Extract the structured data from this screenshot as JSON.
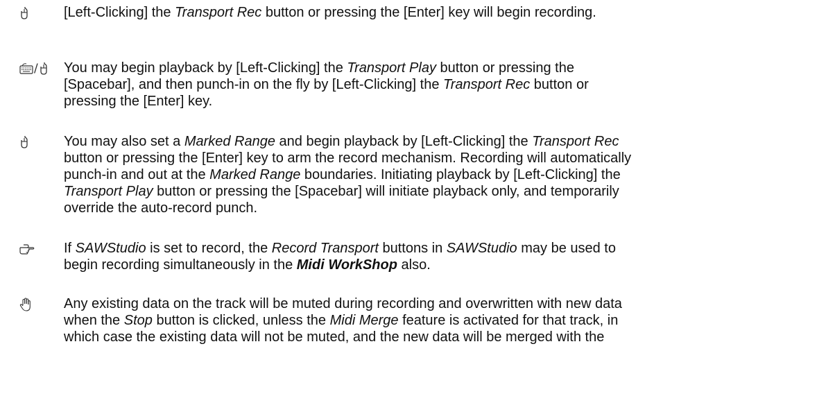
{
  "paragraphs": [
    {
      "icon": "mouse-icon",
      "p1": "[Left-Clicking] the ",
      "i1": "Transport Rec",
      "p2": " button or pressing the [Enter] key will begin recording."
    },
    {
      "icon": "keyboard-icon",
      "icon2": "mouse-icon",
      "icon_sep": "/",
      "p1": "You may begin playback by [Left-Clicking] the ",
      "i1": "Transport Play",
      "p2": " button or pressing the",
      "p3": "[Spacebar], and then punch-in on the fly by [Left-Clicking] the ",
      "i2": "Transport Rec",
      "p4": " button or",
      "p5": "pressing the [Enter] key."
    },
    {
      "icon": "mouse-icon",
      "p1": "You may also set a ",
      "i1": "Marked Range",
      "p2": " and begin playback by [Left-Clicking] the ",
      "i2": "Transport Rec",
      "p3": "button or pressing the [Enter] key to arm the record mechanism. Recording will automatically",
      "p4": "punch-in and out at the ",
      "i3": "Marked Range",
      "p5": " boundaries. Initiating playback by [Left-Clicking] the",
      "i4": "Transport Play",
      "p6": " button or pressing the [Spacebar] will initiate playback only, and temporarily",
      "p7": "override the auto-record punch."
    },
    {
      "icon": "pointing-hand-icon",
      "p1": "If ",
      "i1": "SAWStudio",
      "p2": " is set to record, the ",
      "i2": "Record Transport",
      "p3": " buttons in ",
      "i3": "SAWStudio",
      "p4": " may be used to",
      "p5": "begin recording simultaneously in the ",
      "b1": "Midi WorkShop",
      "p6": " also."
    },
    {
      "icon": "hand-stop-icon",
      "p1": "Any existing data on the track will be muted during recording and overwritten with new data",
      "p2": "when the ",
      "i1": "Stop",
      "p3": " button is clicked, unless the ",
      "i2": "Midi Merge",
      "p4": " feature is activated for that track, in",
      "p5": "which case the existing data will not be muted, and the new data will be merged with the"
    }
  ]
}
